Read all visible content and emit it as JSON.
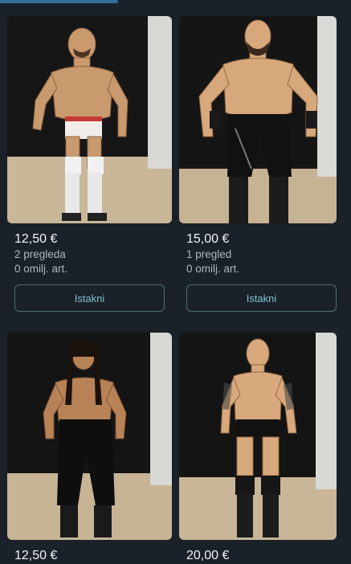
{
  "listings": [
    {
      "price": "12,50 €",
      "views": "2 pregleda",
      "favorites": "0 omilj. art.",
      "button": "Istakni"
    },
    {
      "price": "15,00 €",
      "views": "1 pregled",
      "favorites": "0 omilj. art.",
      "button": "Istakni"
    },
    {
      "price": "12,50 €"
    },
    {
      "price": "20,00 €"
    }
  ],
  "colors": {
    "background": "#1b2128",
    "accent": "#7fc2d2",
    "button_border": "#4d6f78"
  }
}
